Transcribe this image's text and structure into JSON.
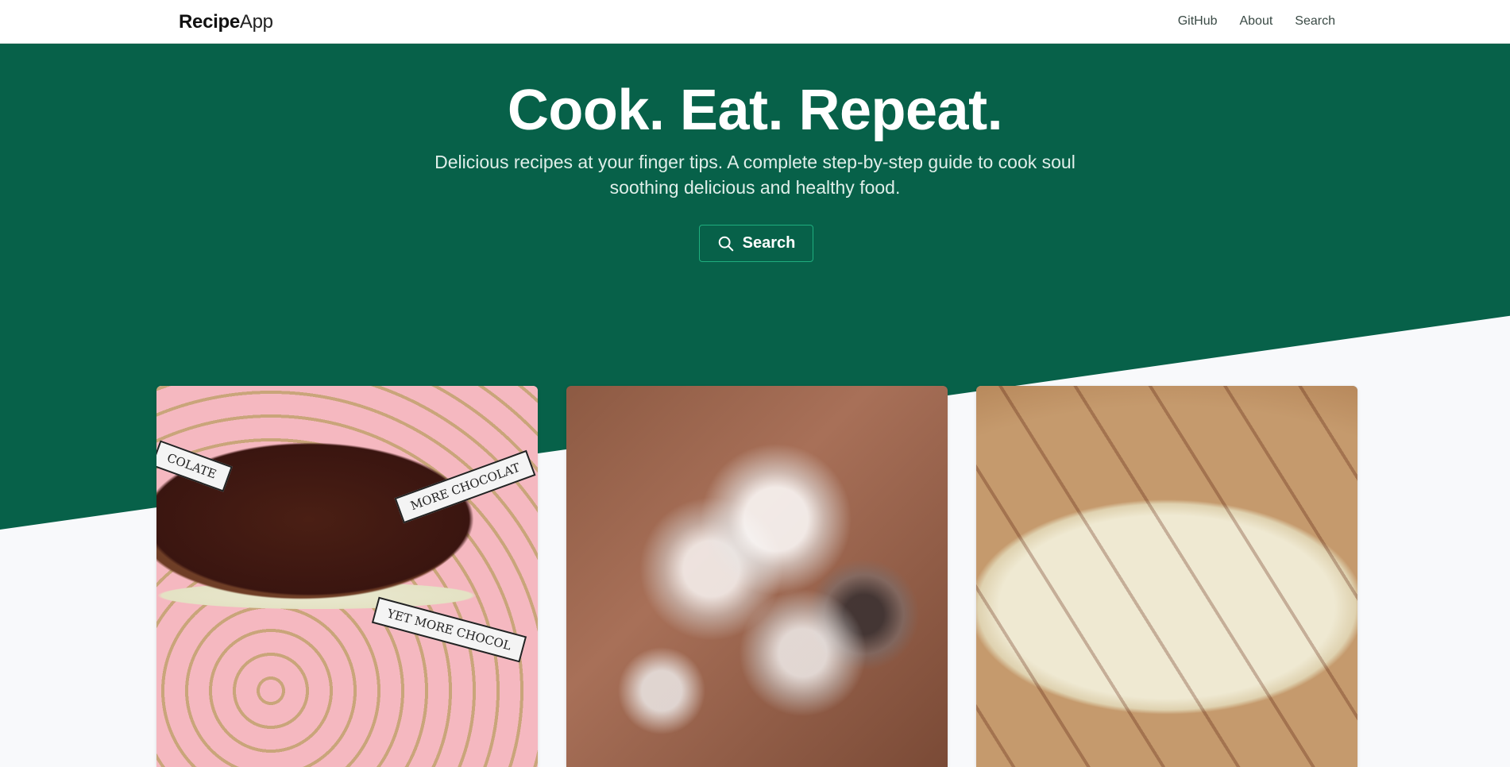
{
  "navbar": {
    "brand_bold": "Recipe",
    "brand_light": "App",
    "links": [
      {
        "label": "GitHub"
      },
      {
        "label": "About"
      },
      {
        "label": "Search"
      }
    ]
  },
  "hero": {
    "title": "Cook. Eat. Repeat.",
    "subtitle": "Delicious recipes at your finger tips. A complete step-by-step guide to cook soul soothing delicious and healthy food.",
    "button_label": "Search",
    "button_icon": "search-icon",
    "background_color": "#076149",
    "accent_color": "#1fae7e"
  },
  "cards": [
    {
      "image": "chocolate-truffle-photo",
      "annotations": [
        "COLATE",
        "MORE CHOCOLAT",
        "YET MORE CHOCOL"
      ]
    },
    {
      "image": "iced-cocoa-photo"
    },
    {
      "image": "chocolate-bark-photo"
    }
  ]
}
